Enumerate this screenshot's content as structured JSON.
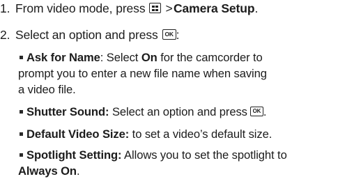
{
  "steps": [
    {
      "number": "1.",
      "text_before": "From video mode, press",
      "icon": "menu-key-icon",
      "separator": ">",
      "bold_text": "Camera Setup",
      "text_after": "."
    },
    {
      "number": "2.",
      "text_before": "Select an option and press",
      "icon": "ok-key-icon",
      "icon_label": "OK",
      "text_after": ":"
    }
  ],
  "options": [
    {
      "term": "Ask for Name",
      "line1_a": ": Select ",
      "line1_bold": "On",
      "line1_b": " for the camcorder to",
      "line2": "prompt you to enter a new file name when saving",
      "line3": "a video file."
    },
    {
      "term": "Shutter Sound:",
      "text": " Select an option and press",
      "icon_label": "OK",
      "text_after": "."
    },
    {
      "term": "Default Video Size:",
      "text": " to set a video’s default size."
    },
    {
      "term": "Spotlight Setting:",
      "line1": " Allows you to set the spotlight to",
      "line2_bold": "Always On",
      "line2_after": "."
    }
  ]
}
